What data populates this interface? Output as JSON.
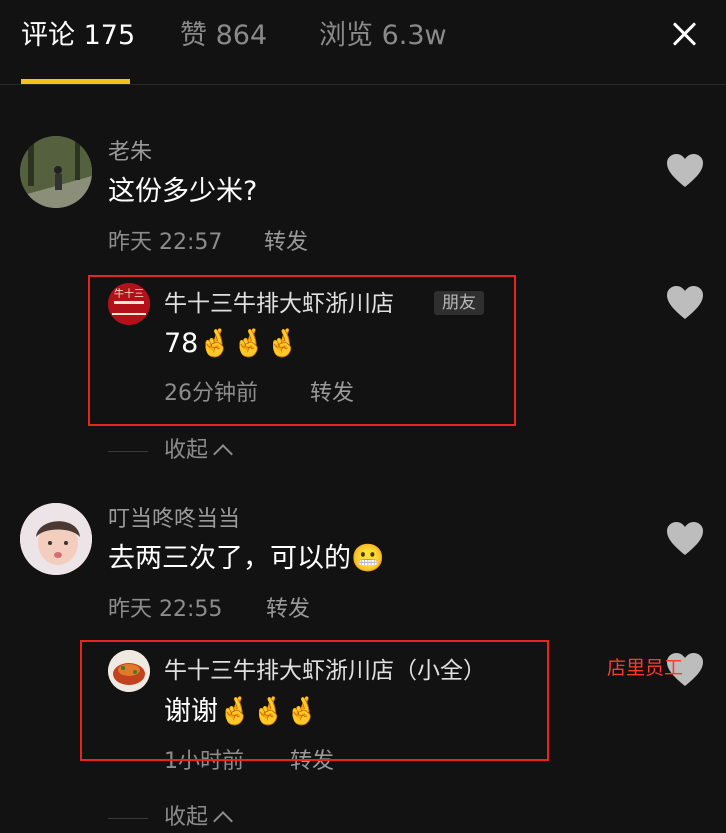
{
  "tabs": [
    {
      "label": "评论 175",
      "active": true
    },
    {
      "label": "赞 864",
      "active": false
    },
    {
      "label": "浏览 6.3w",
      "active": false
    }
  ],
  "close_icon": "close-icon",
  "comments": [
    {
      "author": "老朱",
      "text": "这份多少米?",
      "time": "昨天 22:57",
      "forward": "转发",
      "reply": {
        "author": "牛十三牛排大虾浙川店",
        "badge": "朋友",
        "text": "78🤞🤞🤞",
        "time": "26分钟前",
        "forward": "转发"
      },
      "collapse": "收起"
    },
    {
      "author": "叮当咚咚当当",
      "text": "去两三次了，可以的😬",
      "time": "昨天 22:55",
      "forward": "转发",
      "reply": {
        "author": "牛十三牛排大虾浙川店（小全）",
        "text": "谢谢🤞🤞🤞",
        "time": "1小时前",
        "forward": "转发"
      },
      "collapse": "收起"
    }
  ],
  "annotation": "店里员工",
  "colors": {
    "accent": "#f4c21b",
    "highlight_box": "#e5261c",
    "background": "#121212"
  }
}
